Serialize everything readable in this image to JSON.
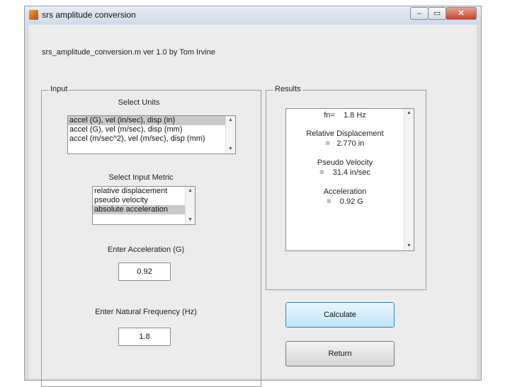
{
  "window": {
    "title": "srs amplitude conversion",
    "controls": {
      "minimize": "–",
      "maximize": "▭",
      "close": "✕"
    }
  },
  "header": "srs_amplitude_conversion.m  ver 1.0   by Tom Irvine",
  "input_panel": {
    "title": "Input",
    "units_label": "Select Units",
    "units_options": [
      {
        "label": "accel (G), vel (in/sec), disp (in)",
        "selected": true
      },
      {
        "label": "accel (G), vel (m/sec), disp (mm)",
        "selected": false
      },
      {
        "label": "accel (m/sec^2), vel (m/sec), disp (mm)",
        "selected": false
      }
    ],
    "metric_label": "Select Input Metric",
    "metric_options": [
      {
        "label": "relative displacement",
        "selected": false
      },
      {
        "label": "pseudo velocity",
        "selected": false
      },
      {
        "label": "absolute acceleration",
        "selected": true
      }
    ],
    "accel_label": "Enter Acceleration (G)",
    "accel_value": "0.92",
    "freq_label": "Enter Natural Frequency (Hz)",
    "freq_value": "1.8"
  },
  "results_panel": {
    "title": "Results",
    "lines": [
      "fn=    1.8 Hz",
      "Relative Displacement",
      "=   2.770 in",
      "Pseudo Velocity",
      "=    31.4 in/sec",
      "Acceleration",
      "=    0.92 G"
    ]
  },
  "buttons": {
    "calculate": "Calculate",
    "return": "Return"
  }
}
